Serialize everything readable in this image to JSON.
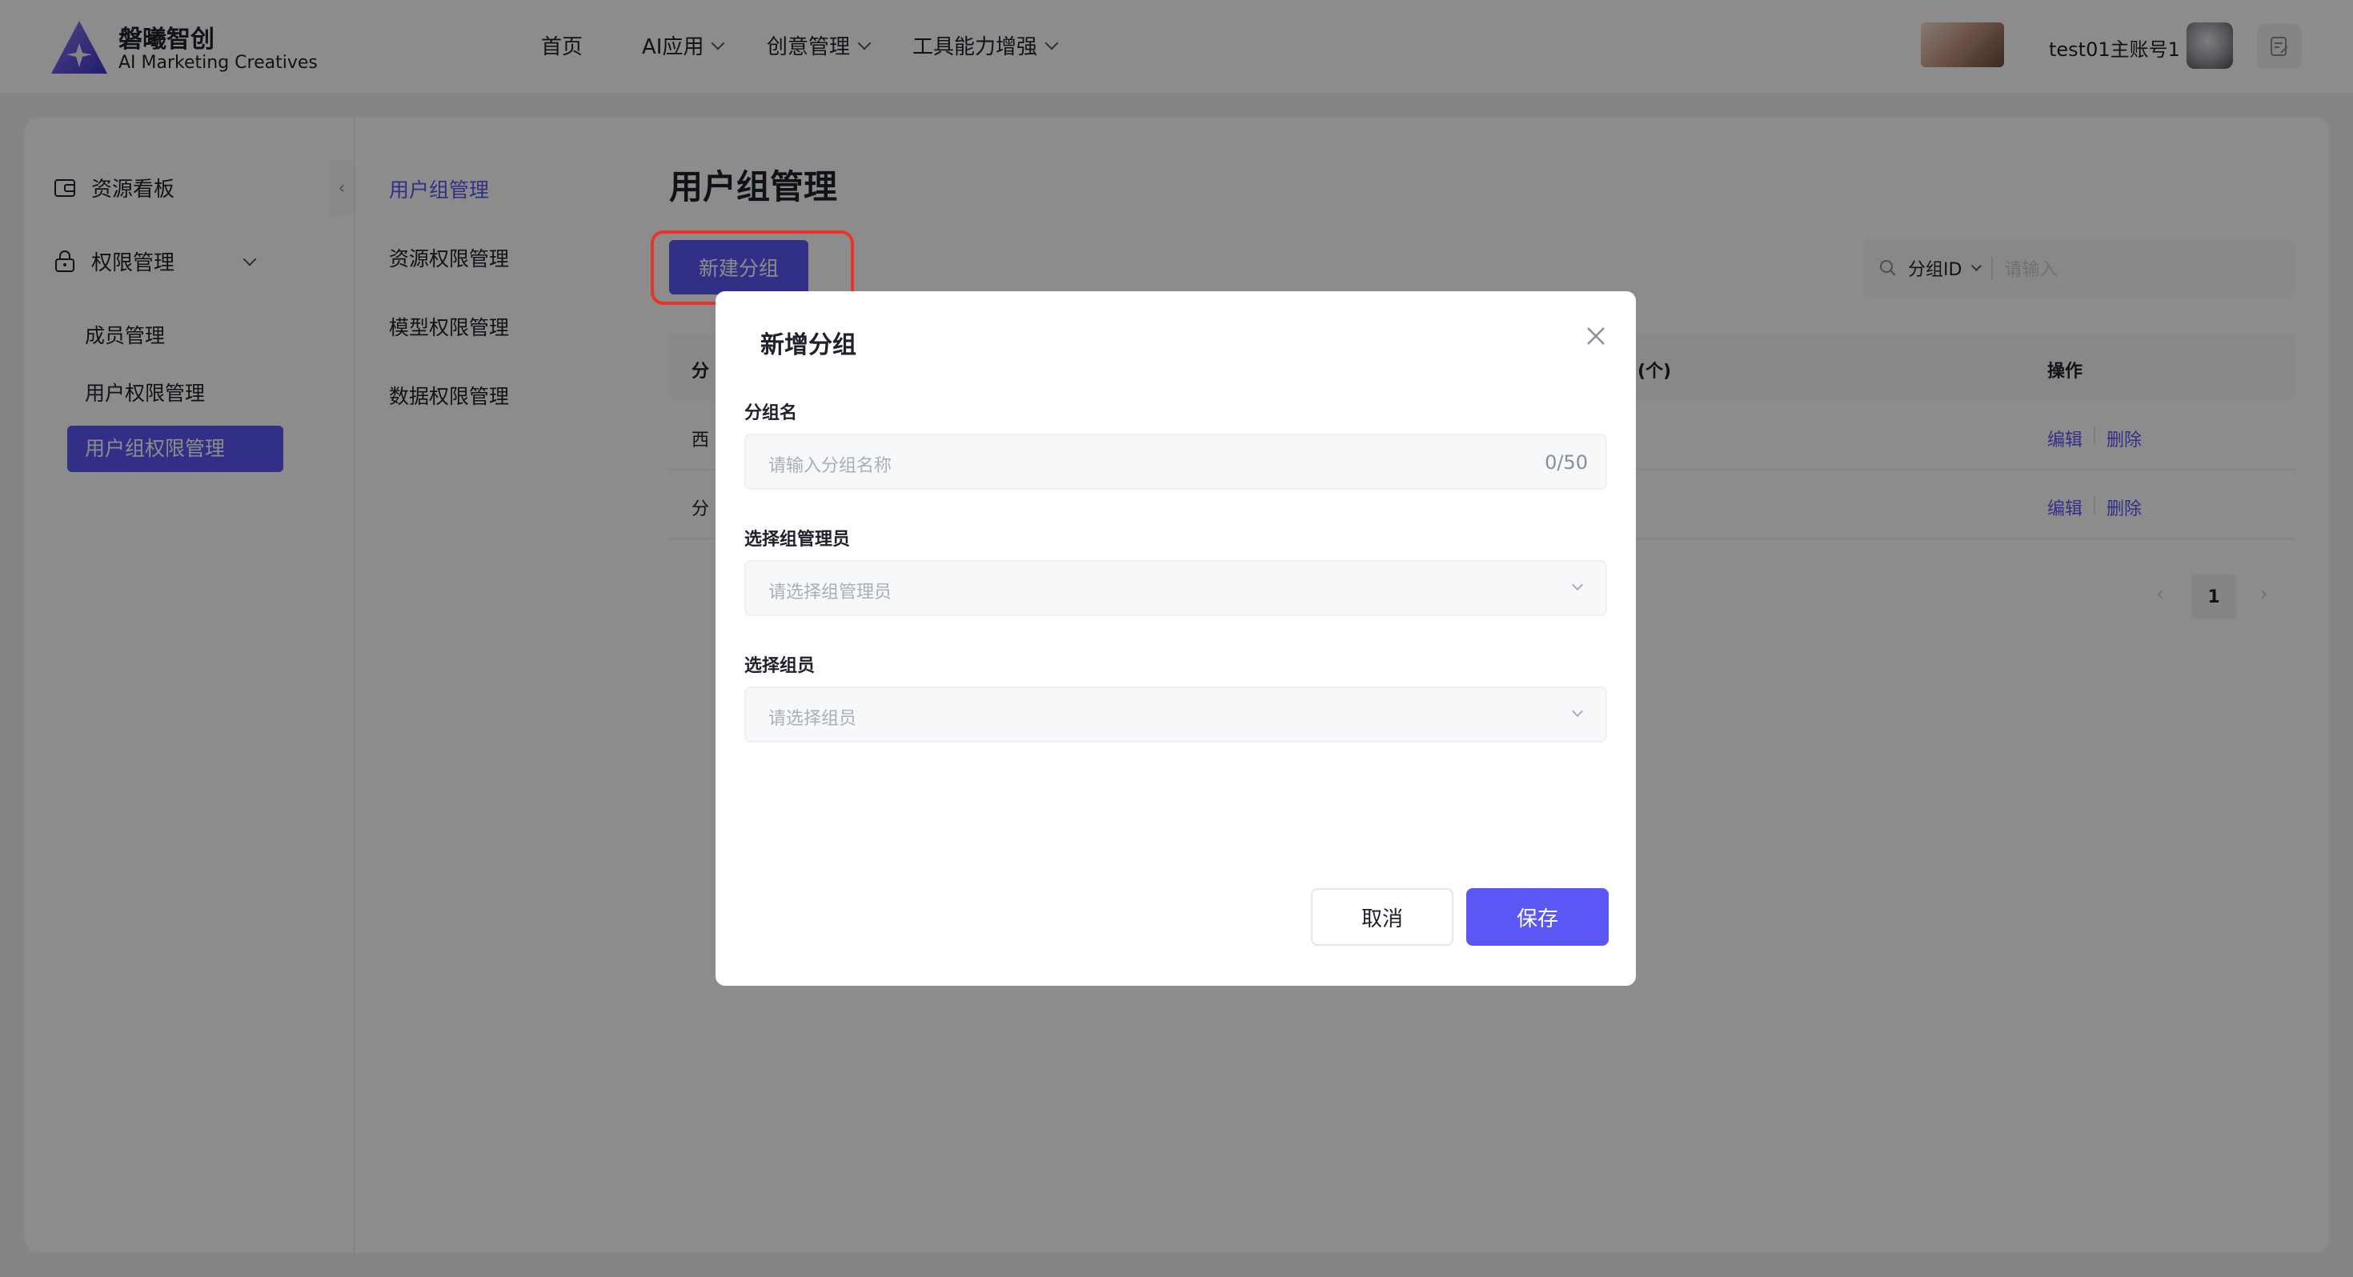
{
  "header": {
    "brand_cn": "磐曦智创",
    "brand_en": "AI Marketing Creatives",
    "nav": [
      {
        "label": "首页",
        "has_dropdown": false
      },
      {
        "label": "AI应用",
        "has_dropdown": true
      },
      {
        "label": "创意管理",
        "has_dropdown": true
      },
      {
        "label": "工具能力增强",
        "has_dropdown": true
      }
    ],
    "user_name": "test01主账号1",
    "icons": [
      "logo-icon",
      "notes-icon"
    ]
  },
  "sidebar": {
    "items": [
      {
        "label": "资源看板",
        "icon": "wallet-icon"
      },
      {
        "label": "权限管理",
        "icon": "lock-icon",
        "expanded": true
      }
    ],
    "sub_items": [
      {
        "label": "成员管理",
        "active": false
      },
      {
        "label": "用户权限管理",
        "active": false
      },
      {
        "label": "用户组权限管理",
        "active": true
      }
    ],
    "collapse_glyph": "‹"
  },
  "mid_menu": {
    "items": [
      {
        "label": "用户组管理",
        "active": true
      },
      {
        "label": "资源权限管理",
        "active": false
      },
      {
        "label": "模型权限管理",
        "active": false
      },
      {
        "label": "数据权限管理",
        "active": false
      }
    ]
  },
  "main": {
    "title": "用户组管理",
    "new_button": "新建分组",
    "search": {
      "filter_label": "分组ID",
      "placeholder": "请输入"
    },
    "table": {
      "header_visible": [
        "分",
        "(个)",
        "操作"
      ],
      "rows": [
        {
          "first_cell": "西",
          "actions": [
            "编辑",
            "删除"
          ]
        },
        {
          "first_cell": "分",
          "actions": [
            "编辑",
            "删除"
          ]
        }
      ]
    },
    "pagination": {
      "current_page": "1",
      "prev": "‹",
      "next": "›"
    }
  },
  "modal": {
    "title": "新增分组",
    "fields": [
      {
        "label": "分组名",
        "placeholder": "请输入分组名称",
        "counter": "0/50",
        "type": "text"
      },
      {
        "label": "选择组管理员",
        "placeholder": "请选择组管理员",
        "type": "select"
      },
      {
        "label": "选择组员",
        "placeholder": "请选择组员",
        "type": "select"
      }
    ],
    "cancel_label": "取消",
    "save_label": "保存"
  },
  "colors": {
    "accent": "#5b57f4",
    "highlight_outline": "#e8342a",
    "mask": "rgba(0,0,0,0.45)"
  }
}
